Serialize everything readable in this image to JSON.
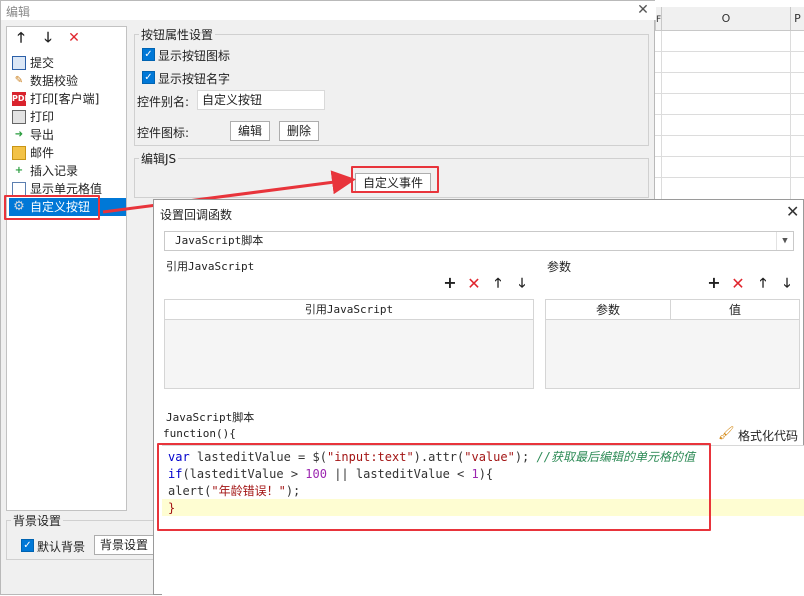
{
  "background_sheet": {
    "columns": [
      "F",
      "O",
      "P"
    ]
  },
  "window": {
    "title": "编辑",
    "close_glyph": "✕",
    "toolbar": {
      "up_glyph": "🡑",
      "down_glyph": "🡓",
      "delete_glyph": "✕"
    },
    "items": [
      {
        "label": "提交",
        "icon": "save-icon"
      },
      {
        "label": "数据校验",
        "icon": "pencil-icon"
      },
      {
        "label": "打印[客户端]",
        "icon": "print-pdf-icon"
      },
      {
        "label": "打印",
        "icon": "printer-icon"
      },
      {
        "label": "导出",
        "icon": "export-icon"
      },
      {
        "label": "邮件",
        "icon": "mail-icon"
      },
      {
        "label": "插入记录",
        "icon": "insert-icon"
      },
      {
        "label": "显示单元格值",
        "icon": "cell-icon"
      },
      {
        "label": "自定义按钮",
        "icon": "gear-icon",
        "selected": true
      }
    ],
    "props": {
      "legend": "按钮属性设置",
      "show_icon": "显示按钮图标",
      "show_name": "显示按钮名字",
      "alias_label": "控件别名:",
      "alias_value": "自定义按钮",
      "icon_label": "控件图标:",
      "edit_btn": "编辑",
      "delete_btn": "删除"
    },
    "js": {
      "legend": "编辑JS",
      "custom_event_btn": "自定义事件"
    },
    "bg": {
      "legend": "背景设置",
      "default_bg": "默认背景",
      "bg_btn": "背景设置"
    }
  },
  "dialog": {
    "title": "设置回调函数",
    "close_glyph": "✕",
    "select_value": "JavaScript脚本",
    "ref_js": {
      "label": "引用JavaScript",
      "column": "引用JavaScript"
    },
    "params": {
      "label": "参数",
      "col_param": "参数",
      "col_value": "值"
    },
    "tools": {
      "add": "+",
      "del": "✕",
      "up": "🡑",
      "down": "🡓"
    },
    "script_label": "JavaScript脚本",
    "function_head": "function(){",
    "format_btn": "格式化代码",
    "code": {
      "l1_kw": "var",
      "l1_a": " lasteditValue = $(",
      "l1_str1": "\"input:text\"",
      "l1_b": ").attr(",
      "l1_str2": "\"value\"",
      "l1_c": "); ",
      "l1_cmt": "//获取最后编辑的单元格的值",
      "l2_kw": "if",
      "l2_a": "(lasteditValue > ",
      "l2_n1": "100",
      "l2_b": " || lasteditValue < ",
      "l2_n2": "1",
      "l2_c": "){",
      "l3_a": "alert(",
      "l3_str": "\"年龄错误！\"",
      "l3_b": ");",
      "l4": "}"
    }
  },
  "colors": {
    "accent": "#0078d7",
    "highlight_box": "#e8343b",
    "code_line_highlight": "#fefdd2"
  }
}
